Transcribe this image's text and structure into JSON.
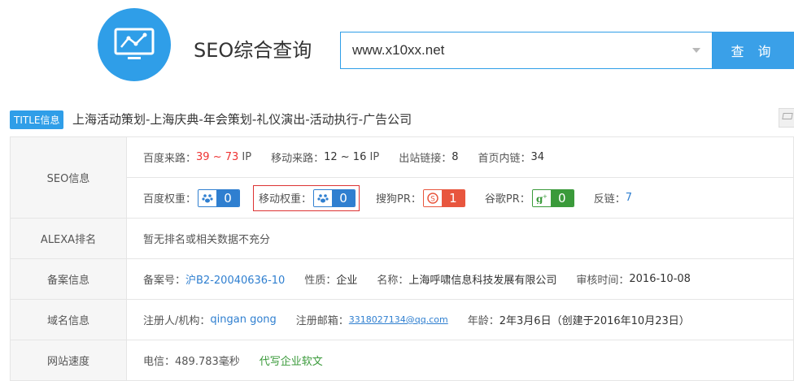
{
  "header": {
    "title": "SEO综合查询",
    "search_value": "www.x10xx.net",
    "search_button": "查 询"
  },
  "site": {
    "tag": "TITLE信息",
    "title": "上海活动策划-上海庆典-年会策划-礼仪演出-活动执行-广告公司"
  },
  "seo": {
    "label": "SEO信息",
    "baidu_traffic_label": "百度来路：",
    "baidu_traffic_value": "39 ~ 73",
    "baidu_traffic_unit": "IP",
    "mobile_traffic_label": "移动来路：",
    "mobile_traffic_value": "12 ~ 16",
    "mobile_traffic_unit": "IP",
    "outlinks_label": "出站链接：",
    "outlinks_value": "8",
    "homepage_links_label": "首页内链：",
    "homepage_links_value": "34",
    "baidu_weight_label": "百度权重：",
    "baidu_weight_value": "0",
    "mobile_weight_label": "移动权重：",
    "mobile_weight_value": "0",
    "sogou_pr_label": "搜狗PR：",
    "sogou_pr_value": "1",
    "google_pr_label": "谷歌PR：",
    "google_pr_value": "0",
    "backlinks_label": "反链：",
    "backlinks_value": "7"
  },
  "alexa": {
    "label": "ALEXA排名",
    "value": "暂无排名或相关数据不充分"
  },
  "icp": {
    "label": "备案信息",
    "number_label": "备案号：",
    "number_value": "沪B2-20040636-10",
    "nature_label": "性质：",
    "nature_value": "企业",
    "name_label": "名称：",
    "name_value": "上海呼啸信息科技发展有限公司",
    "audit_label": "审核时间：",
    "audit_value": "2016-10-08"
  },
  "domain": {
    "label": "域名信息",
    "registrant_label": "注册人/机构：",
    "registrant_value": "qingan gong",
    "email_label": "注册邮箱：",
    "email_value": "3318027134@qq.com",
    "age_label": "年龄：",
    "age_value": "2年3月6日（创建于2016年10月23日）"
  },
  "speed": {
    "label": "网站速度",
    "telecom": "电信：489.783毫秒",
    "link": "代写企业软文"
  },
  "colors": {
    "accent": "#2f9ee8",
    "red": "#e33333",
    "green": "#3a9a3a"
  }
}
